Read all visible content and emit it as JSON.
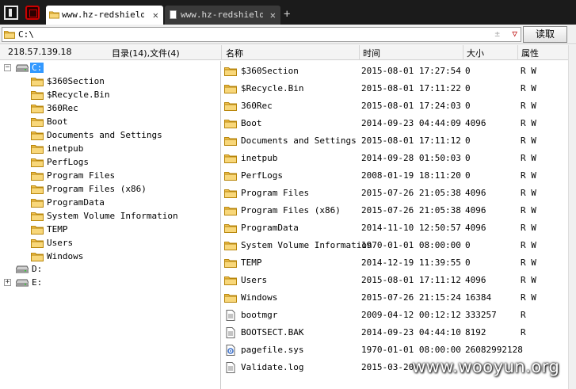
{
  "tabs": [
    {
      "label": "www.hz-redshield...",
      "close": "✕",
      "active": true
    },
    {
      "label": "www.hz-redshield...",
      "close": "✕",
      "active": false
    }
  ],
  "new_tab": "+",
  "address": {
    "value": "C:\\",
    "up": "±",
    "dropdown": "▽",
    "read_label": "读取"
  },
  "info": {
    "ip": "218.57.139.18",
    "stats": "目录(14),文件(4)"
  },
  "columns": {
    "name": "名称",
    "time": "时间",
    "size": "大小",
    "attr": "属性"
  },
  "tree": {
    "drives": [
      {
        "label": "C:",
        "expander": "−",
        "selected": true
      },
      {
        "label": "D:",
        "expander": ""
      },
      {
        "label": "E:",
        "expander": "+"
      }
    ],
    "c_children": [
      "$360Section",
      "$Recycle.Bin",
      "360Rec",
      "Boot",
      "Documents and Settings",
      "inetpub",
      "PerfLogs",
      "Program Files",
      "Program Files (x86)",
      "ProgramData",
      "System Volume Information",
      "TEMP",
      "Users",
      "Windows"
    ]
  },
  "files": [
    {
      "name": "$360Section",
      "time": "2015-08-01 17:27:54",
      "size": "0",
      "attr": "R W",
      "type": "folder"
    },
    {
      "name": "$Recycle.Bin",
      "time": "2015-08-01 17:11:22",
      "size": "0",
      "attr": "R W",
      "type": "folder"
    },
    {
      "name": "360Rec",
      "time": "2015-08-01 17:24:03",
      "size": "0",
      "attr": "R W",
      "type": "folder"
    },
    {
      "name": "Boot",
      "time": "2014-09-23 04:44:09",
      "size": "4096",
      "attr": "R W",
      "type": "folder"
    },
    {
      "name": "Documents and Settings",
      "time": "2015-08-01 17:11:12",
      "size": "0",
      "attr": "R W",
      "type": "folder"
    },
    {
      "name": "inetpub",
      "time": "2014-09-28 01:50:03",
      "size": "0",
      "attr": "R W",
      "type": "folder"
    },
    {
      "name": "PerfLogs",
      "time": "2008-01-19 18:11:20",
      "size": "0",
      "attr": "R W",
      "type": "folder"
    },
    {
      "name": "Program Files",
      "time": "2015-07-26 21:05:38",
      "size": "4096",
      "attr": "R W",
      "type": "folder"
    },
    {
      "name": "Program Files (x86)",
      "time": "2015-07-26 21:05:38",
      "size": "4096",
      "attr": "R W",
      "type": "folder"
    },
    {
      "name": "ProgramData",
      "time": "2014-11-10 12:50:57",
      "size": "4096",
      "attr": "R W",
      "type": "folder"
    },
    {
      "name": "System Volume Information",
      "time": "1970-01-01 08:00:00",
      "size": "0",
      "attr": "R W",
      "type": "folder"
    },
    {
      "name": "TEMP",
      "time": "2014-12-19 11:39:55",
      "size": "0",
      "attr": "R W",
      "type": "folder"
    },
    {
      "name": "Users",
      "time": "2015-08-01 17:11:12",
      "size": "4096",
      "attr": "R W",
      "type": "folder"
    },
    {
      "name": "Windows",
      "time": "2015-07-26 21:15:24",
      "size": "16384",
      "attr": "R W",
      "type": "folder"
    },
    {
      "name": "bootmgr",
      "time": "2009-04-12 00:12:12",
      "size": "333257",
      "attr": "R",
      "type": "file"
    },
    {
      "name": "BOOTSECT.BAK",
      "time": "2014-09-23 04:44:10",
      "size": "8192",
      "attr": "R",
      "type": "file"
    },
    {
      "name": "pagefile.sys",
      "time": "1970-01-01 08:00:00",
      "size": "26082992128",
      "attr": "",
      "type": "sys"
    },
    {
      "name": "Validate.log",
      "time": "2015-03-20",
      "size": "",
      "attr": "",
      "type": "file"
    }
  ],
  "watermark": "www.wooyun.org",
  "colors": {
    "tab_bar": "#1b1b1b",
    "selection": "#3399ff",
    "folder": "#f5c542"
  }
}
